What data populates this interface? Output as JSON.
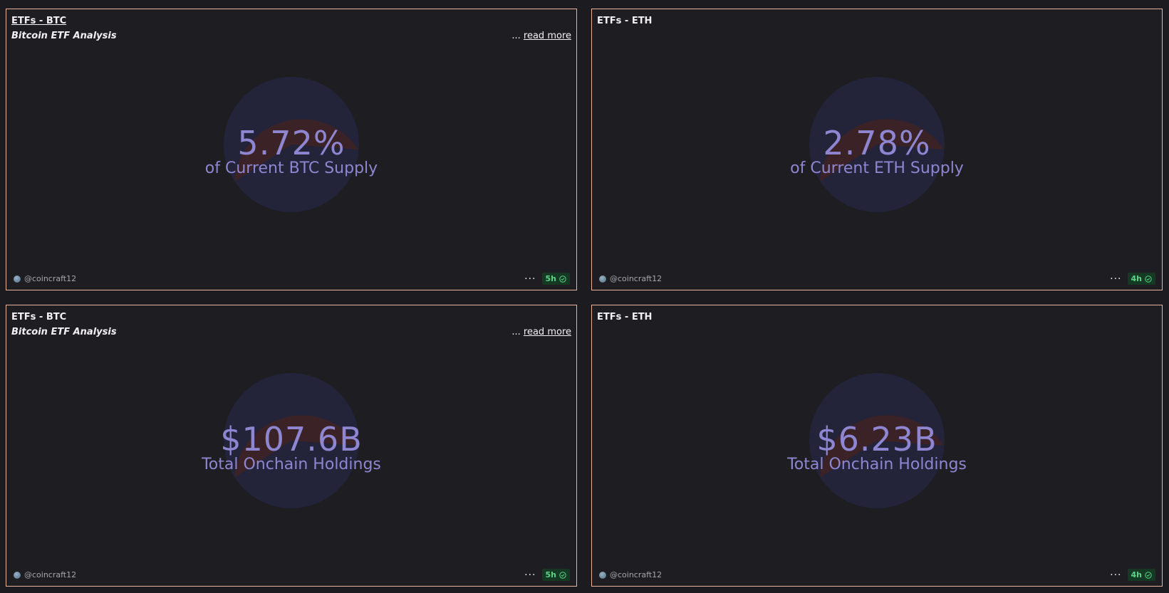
{
  "colors": {
    "border": "#e8b59a",
    "metric_text": "#8e86d1",
    "pie_a": "#3a2226",
    "pie_b": "#23233a",
    "badge_bg": "#143a23",
    "badge_text": "#5fd38a"
  },
  "cards": [
    {
      "title": "ETFs - BTC",
      "subtitle": "Bitcoin ETF Analysis",
      "read_more_ellipsis": "...",
      "read_more_label": "read more",
      "value": "5.72%",
      "label": "of Current BTC Supply",
      "author": "@coincraft12",
      "menu": "···",
      "age": "5h",
      "status_icon": "check-circle-icon"
    },
    {
      "title": "ETFs - ETH",
      "value": "2.78%",
      "label": "of Current ETH Supply",
      "author": "@coincraft12",
      "menu": "···",
      "age": "4h",
      "status_icon": "check-circle-icon"
    },
    {
      "title": "ETFs - BTC",
      "subtitle": "Bitcoin ETF Analysis",
      "read_more_ellipsis": "...",
      "read_more_label": "read more",
      "value": "$107.6B",
      "label": "Total Onchain Holdings",
      "author": "@coincraft12",
      "menu": "···",
      "age": "5h",
      "status_icon": "check-circle-icon"
    },
    {
      "title": "ETFs - ETH",
      "value": "$6.23B",
      "label": "Total Onchain Holdings",
      "author": "@coincraft12",
      "menu": "···",
      "age": "4h",
      "status_icon": "check-circle-icon"
    }
  ]
}
